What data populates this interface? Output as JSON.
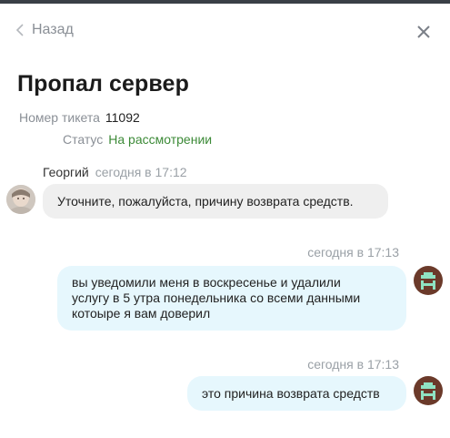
{
  "header": {
    "back_label": "Назад",
    "close_icon": "close-icon",
    "back_icon": "chevron-left-icon"
  },
  "ticket": {
    "title": "Пропал сервер",
    "number_label": "Номер тикета",
    "number_value": "11092",
    "status_label": "Статус",
    "status_value": "На рассмотрении",
    "status_color": "#3c8a37"
  },
  "messages": [
    {
      "author": "Георгий",
      "time": "сегодня в 17:12",
      "text": "Уточните, пожалуйста, причину возврата средств.",
      "side": "agent"
    },
    {
      "time": "сегодня в 17:13",
      "lines": [
        "вы уведомили меня в воскресенье и удалили",
        "услугу в 5 утра понедельника со всеми данными",
        "котоыре я вам доверил"
      ],
      "side": "user"
    },
    {
      "time": "сегодня в 17:13",
      "text": "это причина возврата средств",
      "side": "user"
    }
  ],
  "colors": {
    "agent_bubble": "#efefef",
    "user_bubble": "#e6f7fd",
    "user_avatar_bg": "#6b3a2a",
    "user_avatar_fg": "#8fe3c2"
  }
}
